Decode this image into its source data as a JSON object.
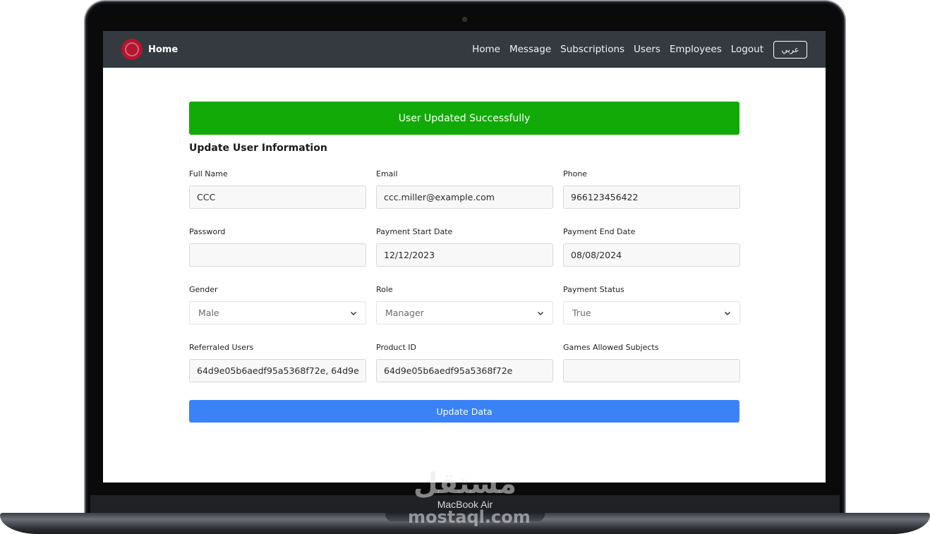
{
  "navbar": {
    "brand_label": "Home",
    "links": [
      "Home",
      "Message",
      "Subscriptions",
      "Users",
      "Employees",
      "Logout"
    ],
    "language_button": "عربي",
    "background_color": "#343a40",
    "logo_color": "#b4152e"
  },
  "alert": {
    "text": "User Updated Successfully",
    "color": "#12aa07"
  },
  "form": {
    "title": "Update User Information",
    "fields": {
      "full_name": {
        "label": "Full Name",
        "value": "CCC"
      },
      "email": {
        "label": "Email",
        "value": "ccc.miller@example.com"
      },
      "phone": {
        "label": "Phone",
        "value": "966123456422"
      },
      "password": {
        "label": "Password",
        "value": ""
      },
      "payment_start_date": {
        "label": "Payment Start Date",
        "value": "12/12/2023"
      },
      "payment_end_date": {
        "label": "Payment End Date",
        "value": "08/08/2024"
      },
      "gender": {
        "label": "Gender",
        "value": "Male"
      },
      "role": {
        "label": "Role",
        "value": "Manager"
      },
      "payment_status": {
        "label": "Payment Status",
        "value": "True"
      },
      "referraled_users": {
        "label": "Referraled Users",
        "value": "64d9e05b6aedf95a5368f72e, 64d9e"
      },
      "product_id": {
        "label": "Product ID",
        "value": "64d9e05b6aedf95a5368f72e"
      },
      "games_allowed_subjects": {
        "label": "Games Allowed Subjects",
        "value": ""
      }
    },
    "submit_label": "Update Data",
    "submit_color": "#3b82f6"
  },
  "device": {
    "model_label": "MacBook Air"
  },
  "watermark": {
    "arabic": "مستقل",
    "latin": "mostaql.com"
  }
}
